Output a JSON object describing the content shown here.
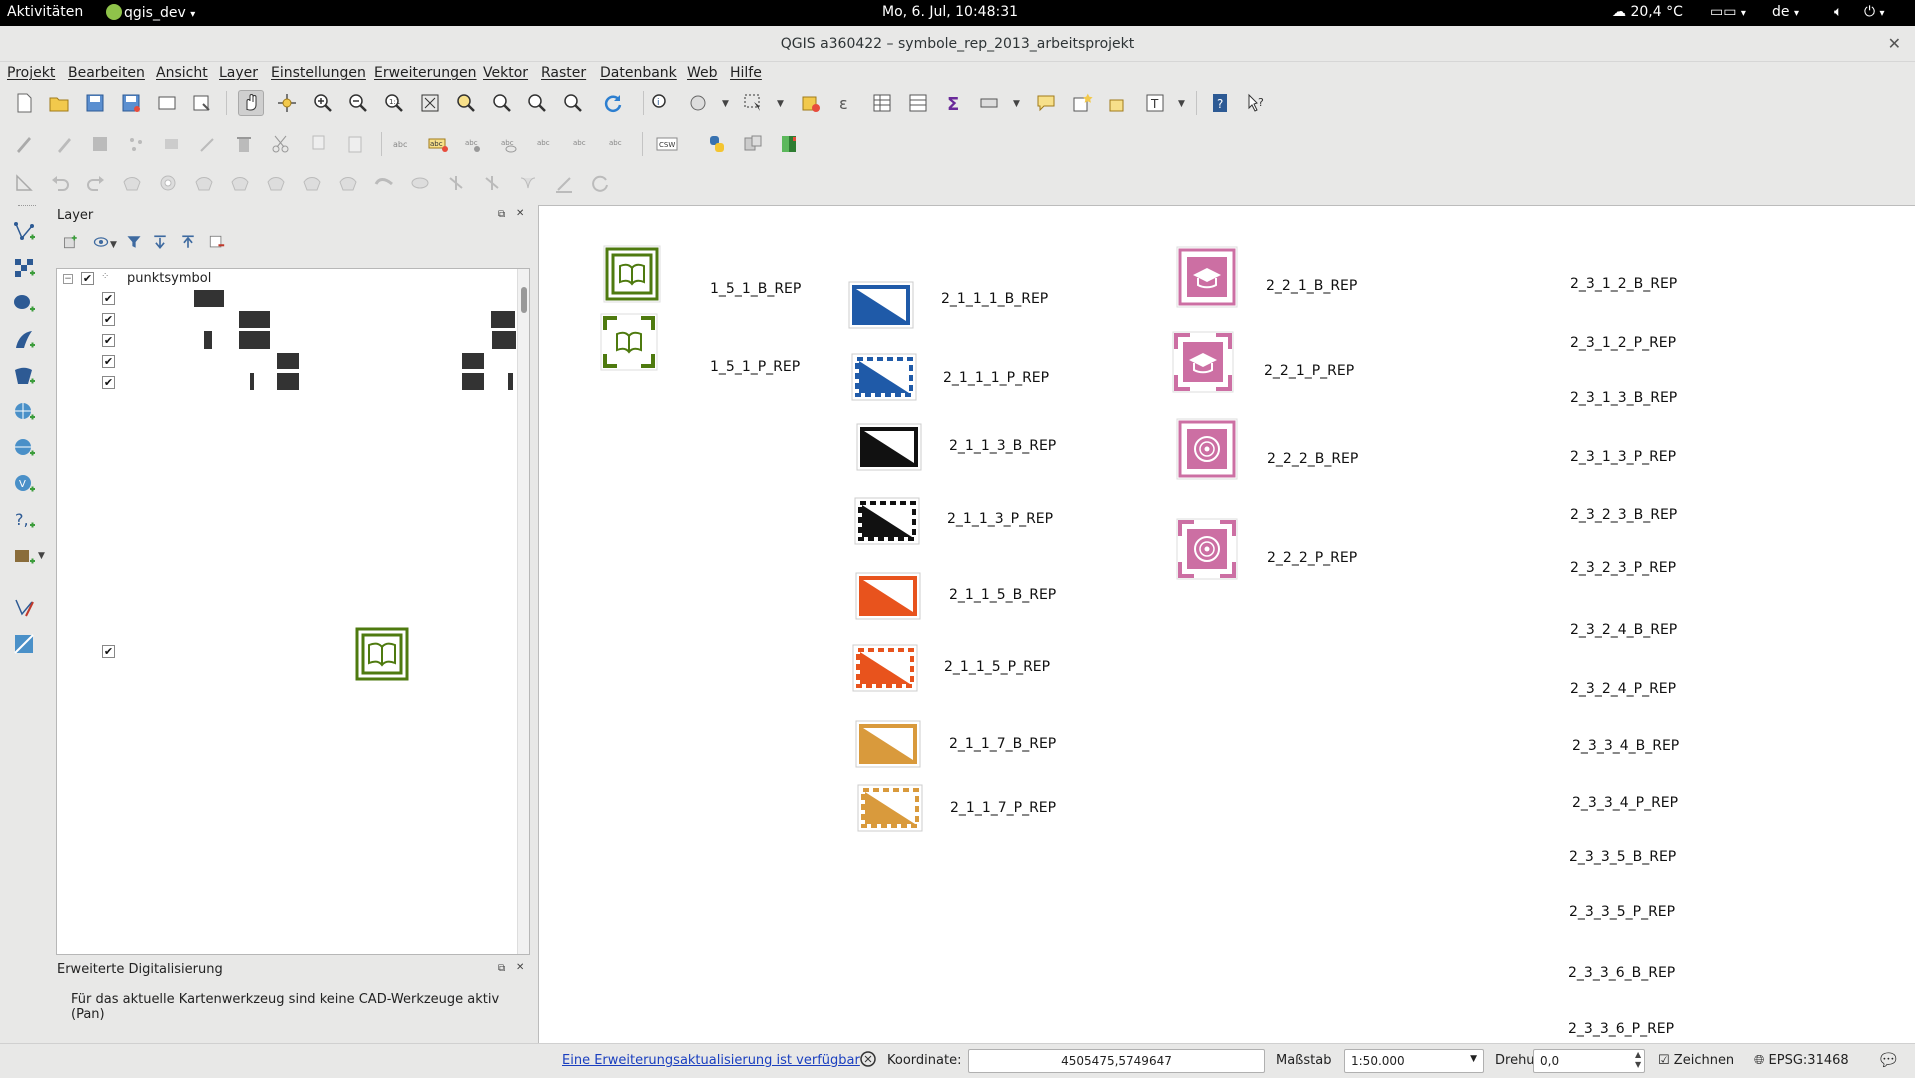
{
  "topbar": {
    "activities": "Aktivitäten",
    "app_menu": "qgis_dev",
    "clock": "Mo,  6. Jul, 10:48:31",
    "weather": "20,4 °C",
    "lang": "de"
  },
  "window": {
    "title": "QGIS a360422 – symbole_rep_2013_arbeitsprojekt"
  },
  "menubar": [
    "Projekt",
    "Bearbeiten",
    "Ansicht",
    "Layer",
    "Einstellungen",
    "Erweiterungen",
    "Vektor",
    "Raster",
    "Datenbank",
    "Web",
    "Hilfe"
  ],
  "toolbar": {
    "csw_label": "CSW"
  },
  "layer_panel": {
    "title": "Layer",
    "group_name": "punktsymbol"
  },
  "cad_panel": {
    "title": "Erweiterte Digitalisierung",
    "message": "Für das aktuelle Kartenwerkzeug sind keine CAD-Werkzeuge aktiv (Pan)"
  },
  "symbols": {
    "col1": [
      "1_5_1_B_REP",
      "1_5_1_P_REP"
    ],
    "col2": [
      "2_1_1_1_B_REP",
      "2_1_1_1_P_REP",
      "2_1_1_3_B_REP",
      "2_1_1_3_P_REP",
      "2_1_1_5_B_REP",
      "2_1_1_5_P_REP",
      "2_1_1_7_B_REP",
      "2_1_1_7_P_REP"
    ],
    "col3": [
      "2_2_1_B_REP",
      "2_2_1_P_REP",
      "2_2_2_B_REP",
      "2_2_2_P_REP"
    ],
    "col4": [
      "2_3_1_2_B_REP",
      "2_3_1_2_P_REP",
      "2_3_1_3_B_REP",
      "2_3_1_3_P_REP",
      "2_3_2_3_B_REP",
      "2_3_2_3_P_REP",
      "2_3_2_4_B_REP",
      "2_3_2_4_P_REP",
      "2_3_3_4_B_REP",
      "2_3_3_4_P_REP",
      "2_3_3_5_B_REP",
      "2_3_3_5_P_REP",
      "2_3_3_6_B_REP",
      "2_3_3_6_P_REP"
    ]
  },
  "colors": {
    "green": "#4e7a0f",
    "blue": "#1f5aa8",
    "orange": "#e8531d",
    "ochre": "#d99a3c",
    "pink": "#cc6fa3",
    "black": "#111111"
  },
  "statusbar": {
    "update_link": "Eine Erweiterungsaktualisierung ist verfügbar",
    "coord_label": "Koordinate:",
    "coord_value": "4505475,5749647",
    "scale_label": "Maßstab",
    "scale_value": "1:50.000",
    "rotation_label": "Drehung:",
    "rotation_value": "0,0",
    "render_label": "Zeichnen",
    "crs": "EPSG:31468"
  }
}
